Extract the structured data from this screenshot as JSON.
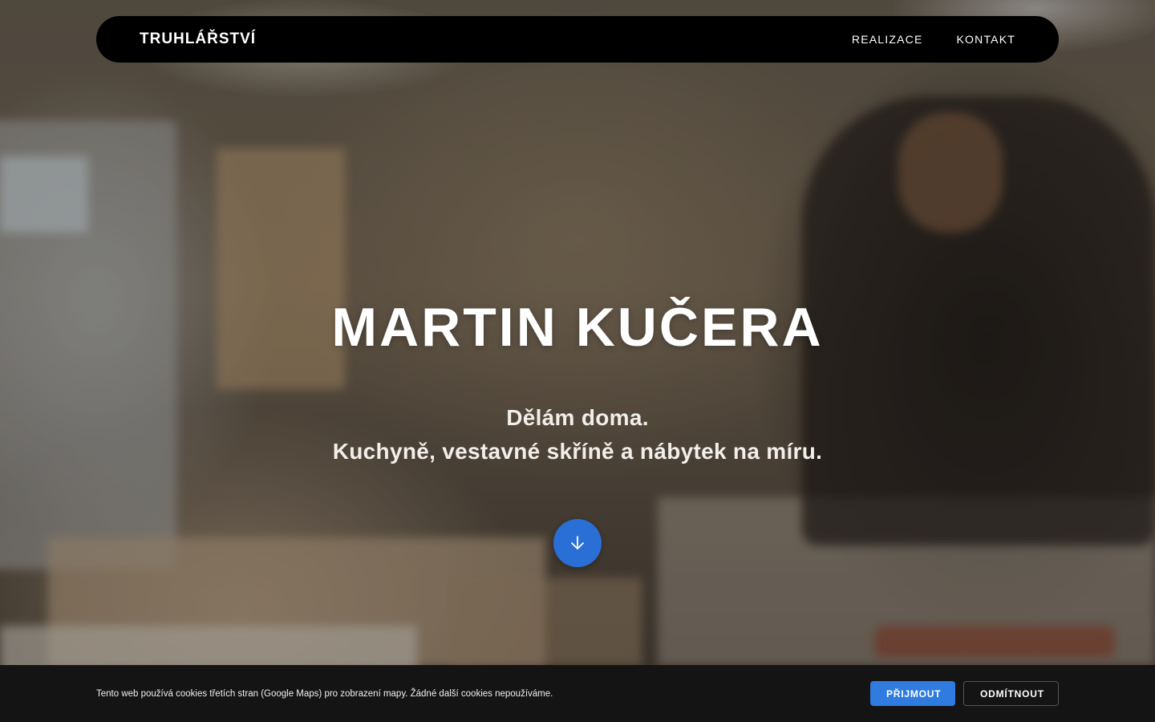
{
  "nav": {
    "brand": "TRUHLÁŘSTVÍ",
    "links": [
      {
        "label": "REALIZACE"
      },
      {
        "label": "KONTAKT"
      }
    ]
  },
  "hero": {
    "title": "MARTIN KUČERA",
    "subtitle_line1": "Dělám doma.",
    "subtitle_line2": "Kuchyně, vestavné skříně a nábytek na míru.",
    "scroll_icon": "arrow-down-icon"
  },
  "cookie": {
    "text": "Tento web používá cookies třetích stran (Google Maps) pro zobrazení mapy. Žádné další cookies nepoužíváme.",
    "accept_label": "PŘIJMOUT",
    "decline_label": "ODMÍTNOUT"
  },
  "colors": {
    "accent": "#2a6fd6",
    "accept_button": "#2f7be0",
    "nav_bg": "#000000",
    "cookie_bg": "#141414"
  }
}
